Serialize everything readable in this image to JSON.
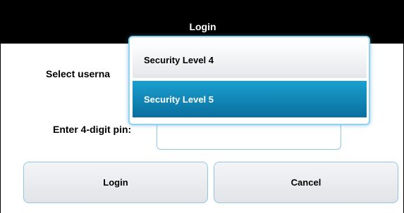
{
  "dialog": {
    "title": "Login"
  },
  "form": {
    "username_label": "Select userna",
    "pin_label": "Enter 4-digit pin:",
    "pin_value": ""
  },
  "buttons": {
    "login": "Login",
    "cancel": "Cancel"
  },
  "dropdown": {
    "options": [
      {
        "label": "Security Level 4",
        "selected": false
      },
      {
        "label": "Security Level 5",
        "selected": true
      }
    ]
  },
  "colors": {
    "titlebar": "#000000",
    "accent": "#8fc6e3",
    "selected_option": "#0a86b8"
  }
}
